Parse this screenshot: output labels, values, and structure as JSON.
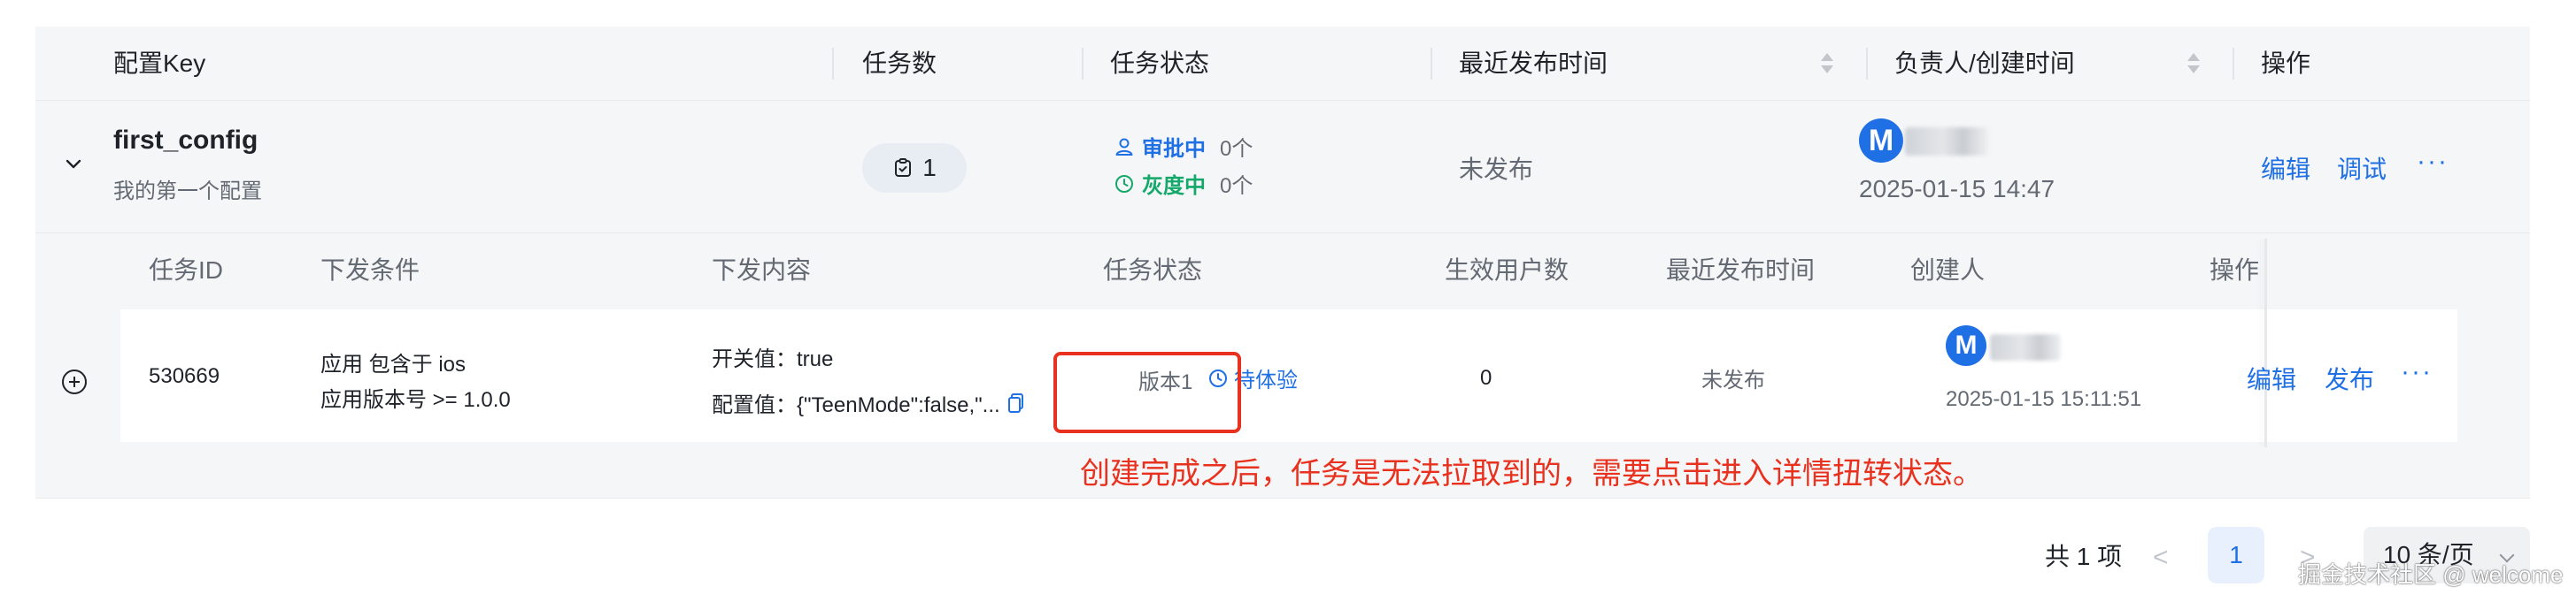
{
  "table": {
    "columns": {
      "config_key": "配置Key",
      "task_count": "任务数",
      "task_status": "任务状态",
      "last_publish_time": "最近发布时间",
      "owner_created": "负责人/创建时间",
      "actions": "操作"
    },
    "row": {
      "config_key": "first_config",
      "description": "我的第一个配置",
      "task_count": "1",
      "status_approving_label": "审批中",
      "status_approving_count": "0个",
      "status_gray_label": "灰度中",
      "status_gray_count": "0个",
      "last_publish": "未发布",
      "owner_initial": "M",
      "created_time": "2025-01-15 14:47",
      "action_edit": "编辑",
      "action_debug": "调试",
      "action_more": "···"
    }
  },
  "subtable": {
    "columns": {
      "task_id": "任务ID",
      "condition": "下发条件",
      "content": "下发内容",
      "status": "任务状态",
      "users": "生效用户数",
      "last_publish": "最近发布时间",
      "creator": "创建人",
      "actions": "操作"
    },
    "row": {
      "task_id": "530669",
      "condition_line1": "应用 包含于 ios",
      "condition_line2": "应用版本号 >= 1.0.0",
      "content_switch": "开关值：true",
      "content_config": "配置值：{\"TeenMode\":false,\"...",
      "version": "版本1",
      "status": "待体验",
      "users": "0",
      "last_publish": "未发布",
      "creator_initial": "M",
      "created_time": "2025-01-15 15:11:51",
      "action_edit": "编辑",
      "action_publish": "发布",
      "action_more": "···"
    }
  },
  "annotation": "创建完成之后，任务是无法拉取到的，需要点击进入详情扭转状态。",
  "pagination": {
    "total": "共 1 项",
    "prev": "<",
    "current_page": "1",
    "next": ">",
    "page_size": "10 条/页"
  },
  "watermark": "掘金技术社区 @ welcome",
  "colors": {
    "primary": "#1f6fe5",
    "approving": "#1f6fe5",
    "gray_release": "#14a86b",
    "highlight": "#e8311e"
  }
}
